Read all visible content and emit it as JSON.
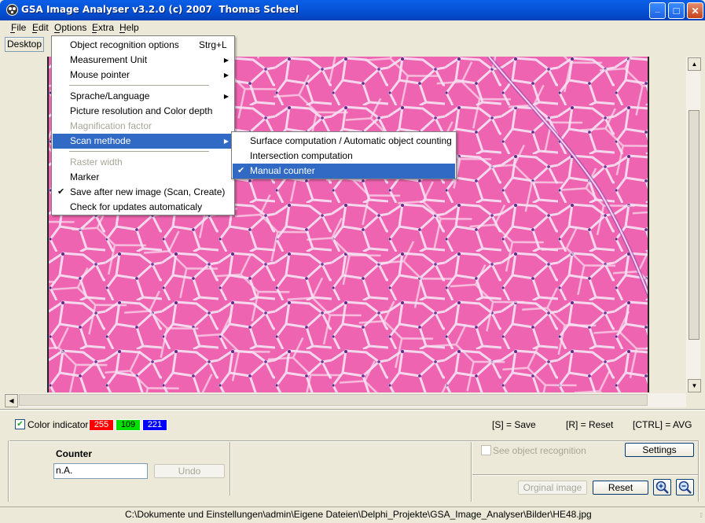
{
  "window": {
    "title": "GSA Image Analyser v3.2.0 (c) 2007  Thomas Scheel",
    "min_glyph": "_",
    "max_glyph": "□",
    "close_glyph": "✕"
  },
  "menubar": [
    "File",
    "Edit",
    "Options",
    "Extra",
    "Help"
  ],
  "desktop_button": "Desktop",
  "options_menu": [
    {
      "label": "Object recognition options",
      "shortcut": "Strg+L"
    },
    {
      "label": "Measurement Unit",
      "submenu": true
    },
    {
      "label": "Mouse pointer",
      "submenu": true
    },
    {
      "label": "Sprache/Language",
      "submenu": true
    },
    {
      "label": "Picture resolution and Color depth"
    },
    {
      "label": "Magnification factor",
      "disabled": true
    },
    {
      "label": "Scan methode",
      "submenu": true,
      "highlighted": true
    },
    {
      "label": "Raster width",
      "disabled": true
    },
    {
      "label": "Marker"
    },
    {
      "label": "Save after new image (Scan, Create)",
      "checked": true
    },
    {
      "label": "Check for updates automaticaly"
    }
  ],
  "scan_submenu": [
    {
      "label": "Surface computation / Automatic object counting"
    },
    {
      "label": "Intersection computation"
    },
    {
      "label": "Manual counter",
      "checked": true,
      "highlighted": true
    }
  ],
  "color_indicator": {
    "label": "Color indicator",
    "checked": true,
    "r": "255",
    "g": "109",
    "b": "221",
    "r_color": "#ff0000",
    "g_color": "#00e000",
    "b_color": "#0000ff"
  },
  "shortcuts": {
    "save": "[S] = Save",
    "reset": "[R] = Reset",
    "avg": "[CTRL] = AVG"
  },
  "counter": {
    "heading": "Counter",
    "value": "n.A.",
    "undo_label": "Undo"
  },
  "right_panel": {
    "see_object_label": "See object recognition",
    "settings_label": "Settings",
    "original_label": "Orginal image",
    "reset_label": "Reset",
    "zoom_in_icon": "zoom-in-icon",
    "zoom_out_icon": "zoom-out-icon"
  },
  "status_path": "C:\\Dokumente und Einstellungen\\admin\\Eigene Dateien\\Delphi_Projekte\\GSA_Image_Analyser\\Bilder\\HE48.jpg"
}
